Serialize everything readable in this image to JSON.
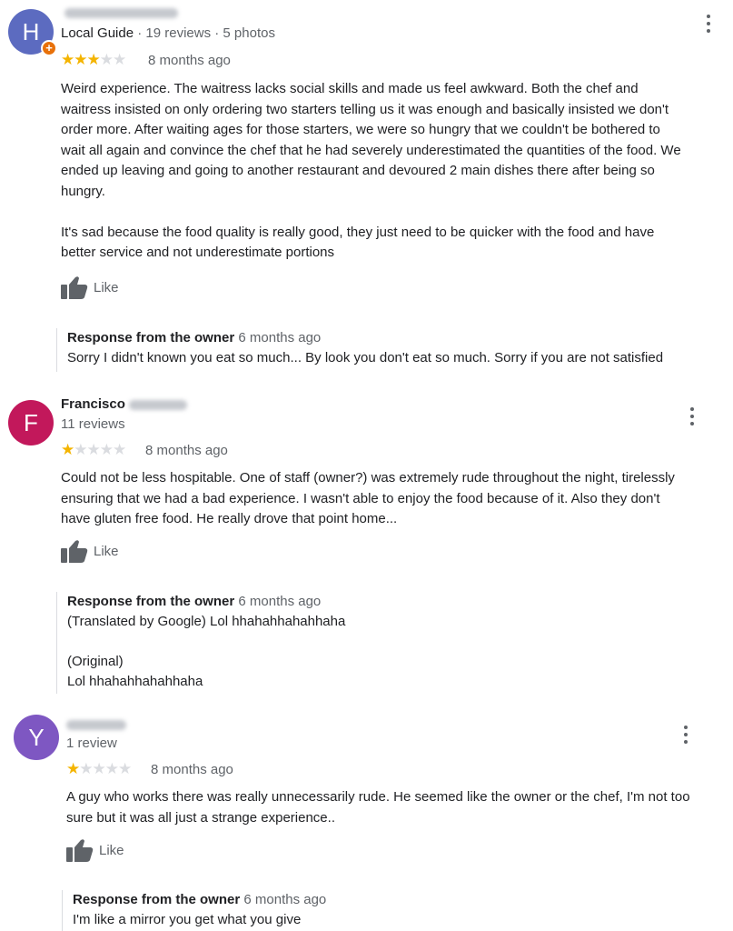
{
  "reviews": [
    {
      "avatar_letter": "H",
      "avatar_color": "#5c6bc0",
      "local_guide_badge": "+",
      "name_visible": "",
      "meta_guide": "Local Guide",
      "meta_counts": " · 19 reviews · 5 photos",
      "rating": 3,
      "time": "8 months ago",
      "text": "Weird experience. The waitress lacks social skills and made us feel awkward.  Both the chef and\nwaitress insisted on only ordering two starters telling us it was enough and basically insisted we don't\norder more.  After waiting ages for those starters,  we were so hungry that we couldn't be bothered to\nwait all again and convince the chef that he had severely underestimated the quantities of the food. We\nended up leaving and going to another restaurant and devoured 2 main dishes there after being so\nhungry.\n\nIt's sad because the food quality is really good,  they just need to be quicker with the food and have\nbetter service and not underestimate portions",
      "like_label": "Like",
      "response_label": "Response from the owner",
      "response_time": "6 months ago",
      "response_text": "Sorry I didn't known you eat so much... By look you don't eat so much. Sorry if you are not satisfied"
    },
    {
      "avatar_letter": "F",
      "avatar_color": "#c2185b",
      "name_visible": "Francisco",
      "meta_counts": "11 reviews",
      "rating": 1,
      "time": "8 months ago",
      "text": "Could not be less hospitable. One of staff (owner?) was extremely rude throughout the night, tirelessly\nensuring that we had a bad experience. I wasn't able to enjoy the food because of it. Also they don't\nhave gluten free food. He really drove that point home...",
      "like_label": "Like",
      "response_label": "Response from the owner",
      "response_time": "6 months ago",
      "response_text": "(Translated by Google) Lol hhahahhahahhaha\n\n(Original)\nLol hhahahhahahhaha"
    },
    {
      "avatar_letter": "Y",
      "avatar_color": "#7e57c2",
      "name_visible": "",
      "meta_counts": "1 review",
      "rating": 1,
      "time": "8 months ago",
      "text": "A guy who works there was really unnecessarily rude. He seemed like the owner or the chef, I'm not too\nsure but it was all just a strange experience..",
      "like_label": "Like",
      "response_label": "Response from the owner",
      "response_time": "6 months ago",
      "response_text": "I'm like a mirror you get what you give"
    }
  ],
  "icons": {
    "like": "thumbs-up-icon",
    "menu": "more-vert-icon"
  }
}
